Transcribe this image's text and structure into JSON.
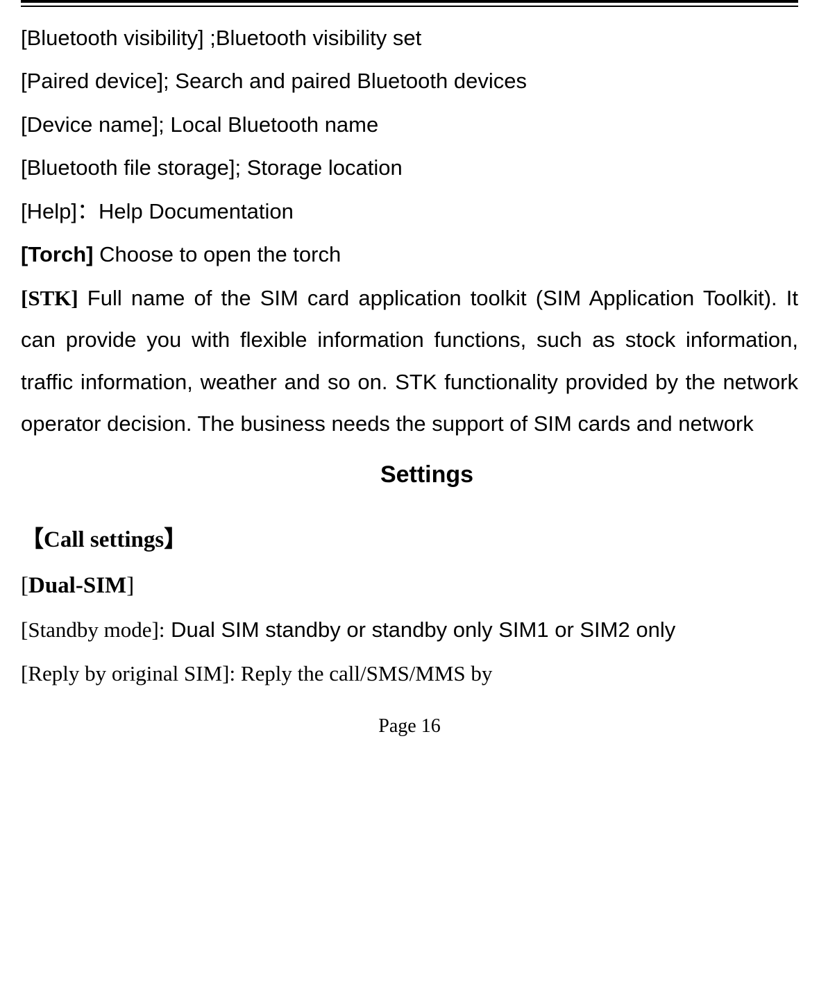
{
  "lines": {
    "bt_visibility": "[Bluetooth visibility] ;Bluetooth visibility set",
    "paired_device": "[Paired device]; Search and paired Bluetooth devices",
    "device_name": "[Device name]; Local Bluetooth name",
    "bt_storage": "[Bluetooth file storage]; Storage location",
    "help": "[Help]：Help Documentation",
    "torch_label": "[Torch]",
    "torch_text": " Choose to open the torch",
    "stk_label": "[STK]",
    "stk_text": " Full name of the SIM card application toolkit (SIM Application Toolkit). It can provide you with flexible information functions, such as stock information, traffic information, weather and so on. STK functionality provided by the network operator decision. The business needs the support of SIM cards and network"
  },
  "heading": "Settings",
  "call_settings_heading": "【Call settings】",
  "dual_sim_bracket_open": "[",
  "dual_sim_label": "Dual-SIM",
  "dual_sim_bracket_close": "]",
  "standby_label": "[Standby mode]:",
  "standby_text": " Dual SIM standby or standby only SIM1 or SIM2 only",
  "reply_label": "[Reply by original SIM]: ",
  "reply_text": "Reply the call/SMS/MMS by",
  "footer": "Page 16"
}
